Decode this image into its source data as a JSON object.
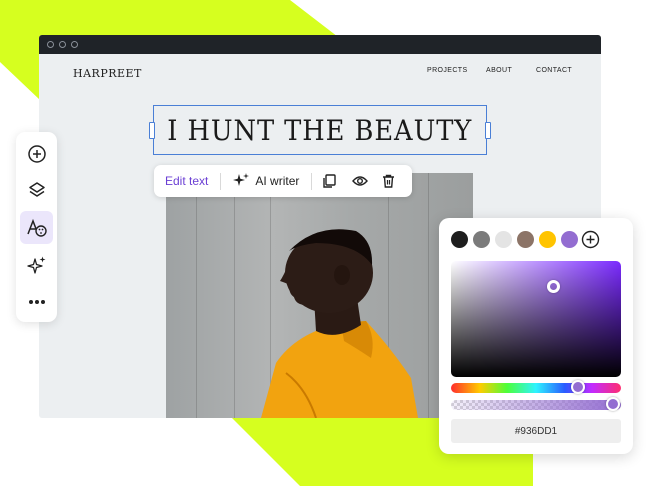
{
  "site": {
    "logo": "HARPREET",
    "nav": [
      "PROJECTS",
      "ABOUT",
      "CONTACT"
    ],
    "headline": "I HUNT THE BEAUTY"
  },
  "toolbar": {
    "edit_text": "Edit text",
    "ai_writer": "AI writer",
    "icons": [
      "sparkle-icon",
      "copy-icon",
      "eye-icon",
      "trash-icon"
    ]
  },
  "sidebar": {
    "items": [
      "add-icon",
      "layers-icon",
      "text-style-icon",
      "sparkle-icon",
      "more-icon"
    ],
    "active": "text-style-icon"
  },
  "color_picker": {
    "swatches": [
      "#1e1e1e",
      "#7b7b7b",
      "#e4e4e4",
      "#8c7467",
      "#ffc400",
      "#936dd1"
    ],
    "hex": "#936DD1",
    "accent": "#7b2bff"
  },
  "colors": {
    "lime": "#d6ff1f",
    "accent": "#6b3fd4",
    "selection": "#4a7fd6"
  }
}
